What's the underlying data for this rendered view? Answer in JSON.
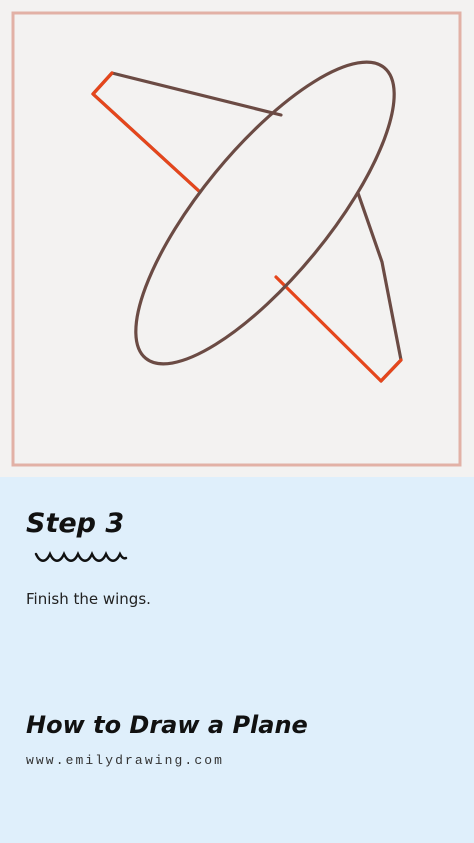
{
  "step": {
    "title": "Step 3",
    "description": "Finish the wings."
  },
  "guide": {
    "title": "How to Draw a Plane",
    "website": "www.emilydrawing.com"
  },
  "colors": {
    "paper": "#f3f2f1",
    "frame": "#e2b1a6",
    "panel": "#dfeffb",
    "existing_lines": "#6b4b44",
    "new_lines": "#e5461c",
    "text": "#111111"
  },
  "icons": {
    "underline": "wave-underline-icon",
    "plane": "plane-drawing"
  }
}
